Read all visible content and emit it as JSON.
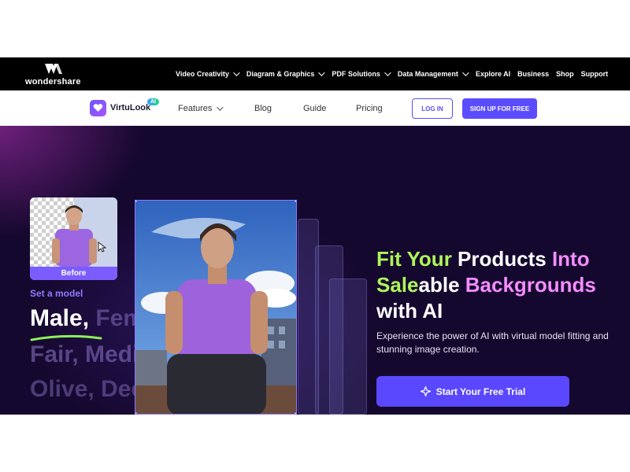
{
  "brand": {
    "name": "wondershare",
    "icon": "wondershare-logo-icon"
  },
  "top_nav": {
    "items": [
      {
        "label": "Video Creativity",
        "dropdown": true
      },
      {
        "label": "Diagram & Graphics",
        "dropdown": true
      },
      {
        "label": "PDF Solutions",
        "dropdown": true
      },
      {
        "label": "Data Management",
        "dropdown": true
      },
      {
        "label": "Explore AI",
        "dropdown": false
      },
      {
        "label": "Business",
        "dropdown": false
      },
      {
        "label": "Shop",
        "dropdown": false
      },
      {
        "label": "Support",
        "dropdown": false
      }
    ]
  },
  "product_nav": {
    "product_name": "VirtuLook",
    "badge": "AI",
    "items": [
      {
        "label": "Features",
        "dropdown": true
      },
      {
        "label": "Blog"
      },
      {
        "label": "Guide"
      },
      {
        "label": "Pricing"
      }
    ],
    "login_label": "LOG IN",
    "signup_label": "SIGN UP FOR FREE"
  },
  "hero": {
    "before_label": "Before",
    "set_model_label": "Set a model",
    "tones": {
      "line1_primary": "Male,",
      "line1_faded": " Female",
      "line2": "Fair, Medium",
      "line3": "Olive, Deep"
    },
    "headline": {
      "line1_word1": "Fit Your",
      "line1_word2": " Products ",
      "line1_word3": "Into",
      "line2_word1": "Sale",
      "line2_word2": "able ",
      "line2_word3": "Backgrounds",
      "line3": "with AI"
    },
    "subtext": "Experience the power of AI with virtual model fitting and stunning image creation.",
    "cta_label": "Start Your Free Trial",
    "colors": {
      "accent": "#5a48ff",
      "highlight_green": "#aef55a",
      "highlight_pink": "#f48cff",
      "background": "#15082e"
    }
  }
}
